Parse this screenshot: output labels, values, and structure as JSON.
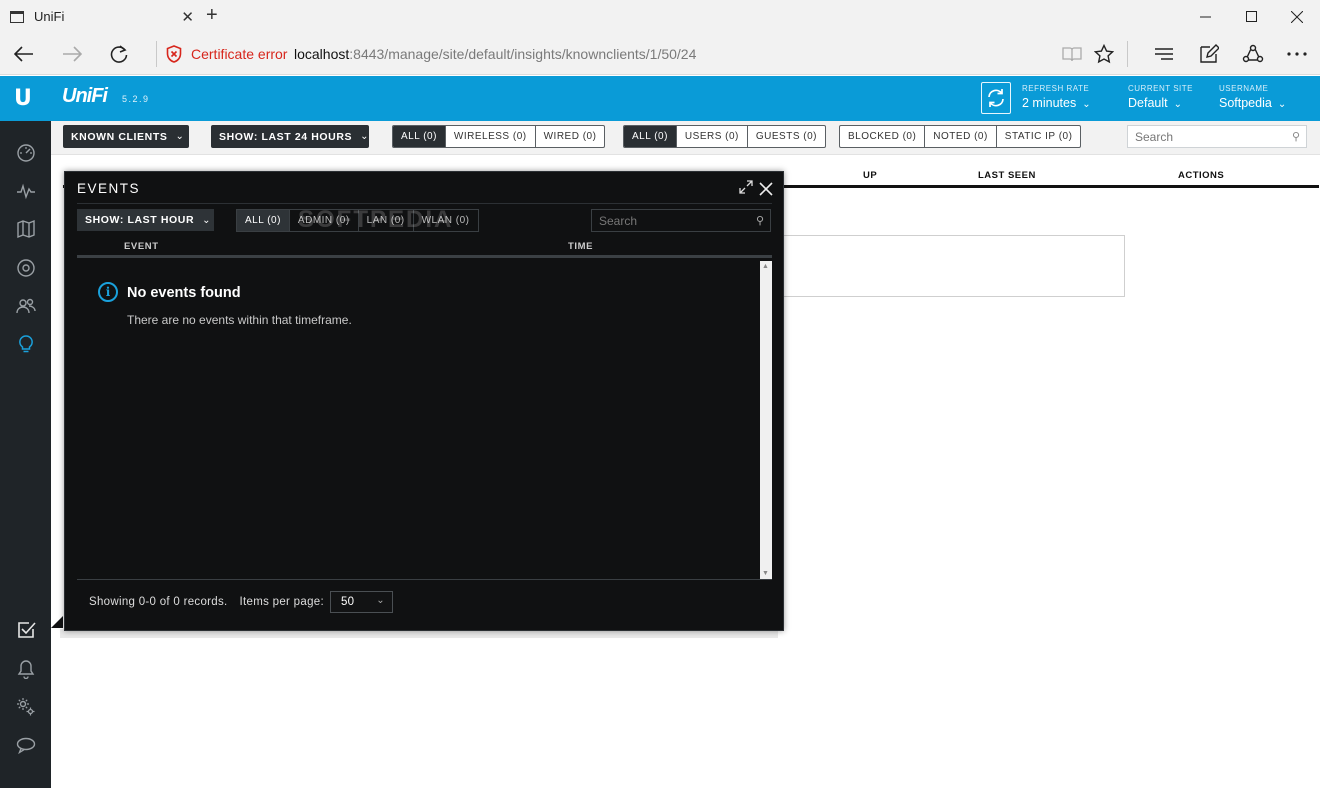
{
  "browser": {
    "tab_title": "UniFi",
    "tab_close": "✕",
    "new_tab": "+",
    "cert_error": "Certificate error",
    "url_host": "localhost",
    "url_rest": ":8443/manage/site/default/insights/knownclients/1/50/24",
    "icons": [
      "back-icon",
      "forward-icon",
      "refresh-icon",
      "reading-view-icon",
      "favorite-star-icon",
      "hub-icon",
      "web-note-icon",
      "share-icon",
      "more-icon"
    ]
  },
  "app": {
    "logo": "U",
    "brand": "UniFi",
    "version": "5.2.9",
    "refresh_rate": {
      "label": "REFRESH RATE",
      "value": "2 minutes"
    },
    "current_site": {
      "label": "CURRENT SITE",
      "value": "Default"
    },
    "username": {
      "label": "USERNAME",
      "value": "Softpedia"
    },
    "accent": "#0a9bd7"
  },
  "sidebar": {
    "items": [
      "dashboard-icon",
      "statistics-icon",
      "map-icon",
      "devices-icon",
      "clients-icon",
      "insights-icon"
    ],
    "bottom_items": [
      "tasks-icon",
      "alerts-icon",
      "settings-icon",
      "chat-icon"
    ],
    "active": "insights-icon"
  },
  "toolbar": {
    "view_dropdown": "KNOWN CLIENTS",
    "time_dropdown": "SHOW: LAST 24 HOURS",
    "connection_filters": [
      "ALL (0)",
      "WIRELESS (0)",
      "WIRED (0)"
    ],
    "type_filters": [
      "ALL (0)",
      "USERS (0)",
      "GUESTS (0)"
    ],
    "status_filters": [
      "BLOCKED (0)",
      "NOTED (0)",
      "STATIC IP (0)"
    ],
    "search_placeholder": "Search"
  },
  "table": {
    "columns": [
      "UP",
      "LAST SEEN",
      "ACTIONS"
    ]
  },
  "events_modal": {
    "title": "EVENTS",
    "time_dropdown": "SHOW: LAST HOUR",
    "filters": [
      "ALL (0)",
      "ADMIN (0)",
      "LAN (0)",
      "WLAN (0)"
    ],
    "search_placeholder": "Search",
    "columns": [
      "EVENT",
      "TIME"
    ],
    "empty_title": "No events found",
    "empty_description": "There are no events within that timeframe.",
    "footer_records": "Showing 0-0 of 0 records.",
    "footer_items_label": "Items per page:",
    "items_per_page": "50",
    "watermark": "SOFTPEDIA"
  }
}
